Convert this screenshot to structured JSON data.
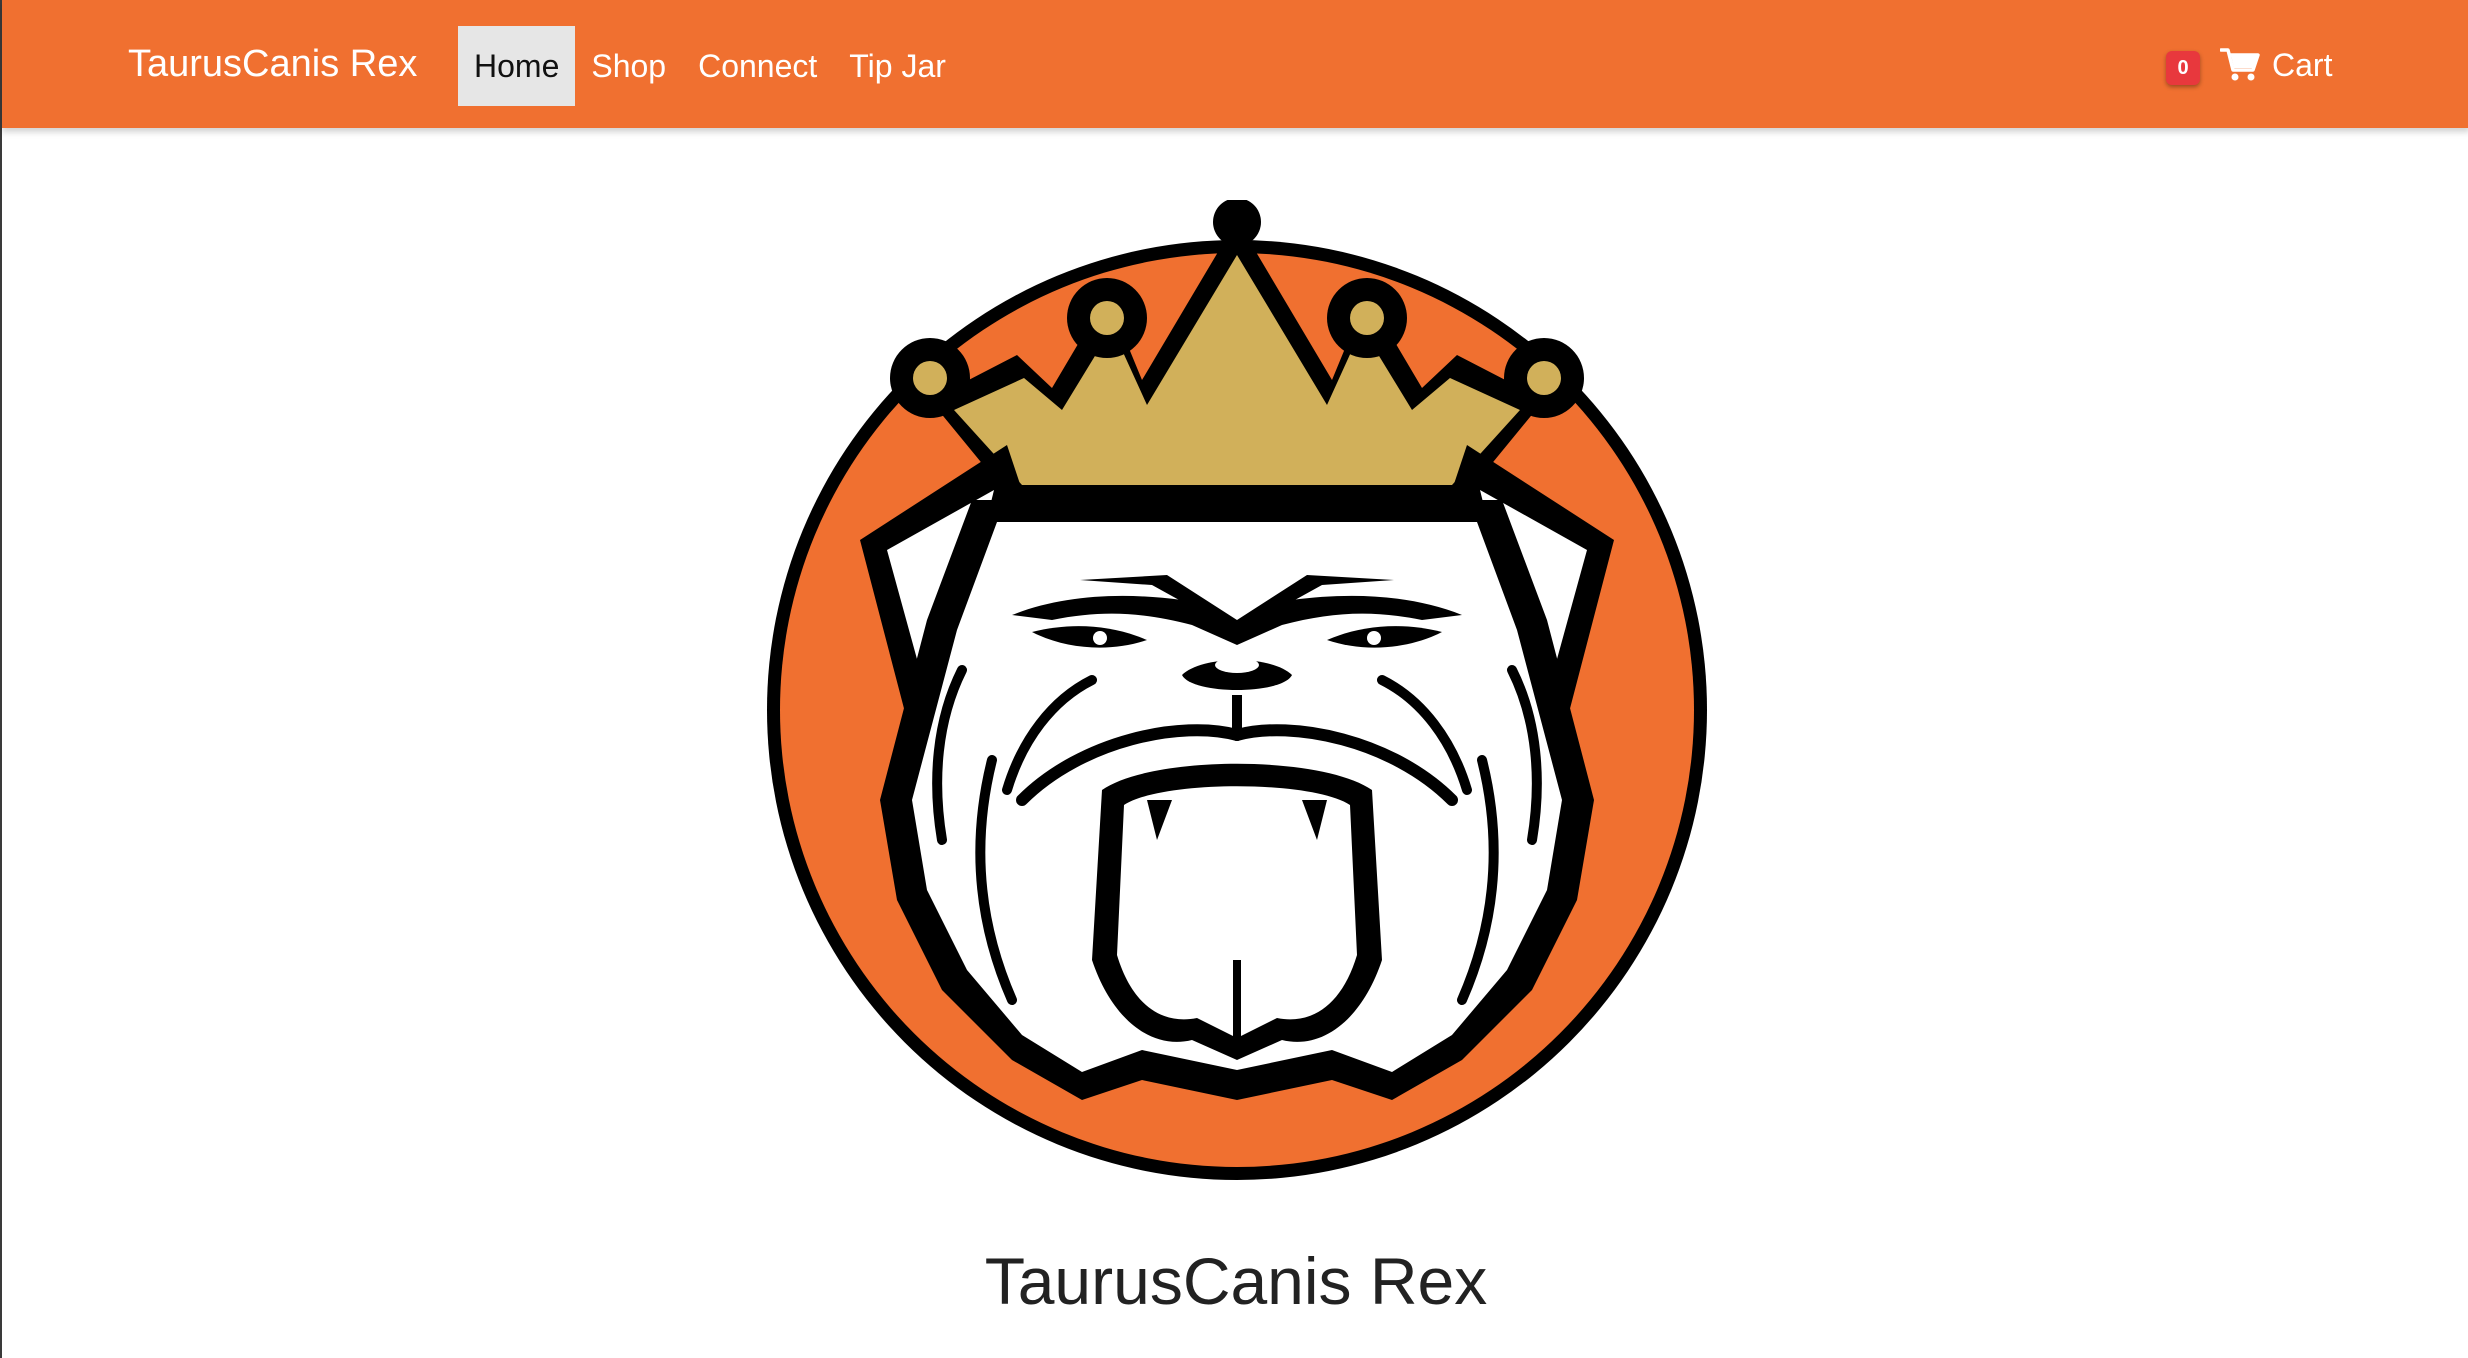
{
  "navbar": {
    "brand": "TaurusCanis Rex",
    "links": [
      {
        "label": "Home",
        "active": true
      },
      {
        "label": "Shop",
        "active": false
      },
      {
        "label": "Connect",
        "active": false
      },
      {
        "label": "Tip Jar",
        "active": false
      }
    ],
    "cart": {
      "count": "0",
      "label": "Cart",
      "icon": "shopping-cart-icon"
    }
  },
  "hero": {
    "logo_icon": "crowned-bulldog-logo",
    "title": "TaurusCanis Rex"
  },
  "colors": {
    "brand_orange": "#f07030",
    "crown_gold": "#d1b05a",
    "badge_red": "#e8383d",
    "active_link_bg": "#e6e6e6"
  }
}
